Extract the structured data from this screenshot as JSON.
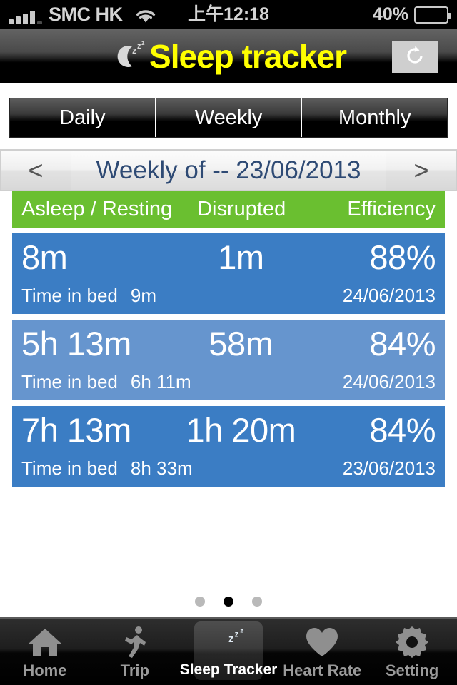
{
  "statusbar": {
    "carrier": "SMC HK",
    "time": "上午12:18",
    "battery_percent": "40%",
    "battery_level": 40,
    "signal_icon": "signal-bars-icon",
    "wifi_icon": "wifi-icon",
    "battery_icon": "battery-icon"
  },
  "header": {
    "title": "Sleep tracker",
    "title_color": "#ffff00",
    "moon_icon": "sleep-moon-zzz-icon",
    "refresh_icon": "refresh-icon",
    "refresh_label": "Refresh"
  },
  "segments": {
    "items": [
      {
        "label": "Daily",
        "selected": false
      },
      {
        "label": "Weekly",
        "selected": true
      },
      {
        "label": "Monthly",
        "selected": false
      }
    ]
  },
  "datenav": {
    "prev_label": "<",
    "next_label": ">",
    "current": "Weekly of -- 23/06/2013",
    "text_color": "#2e4a74"
  },
  "table": {
    "header_color": "#6abf30",
    "columns": [
      "Asleep / Resting",
      "Disrupted",
      "Efficiency"
    ],
    "sub_label": "Time in bed",
    "row_colors": [
      "#3b7dc4",
      "#6695ce"
    ],
    "rows": [
      {
        "asleep": "8m",
        "disrupted": "1m",
        "efficiency": "88%",
        "time_in_bed_label": "Time in bed",
        "time_in_bed": "9m",
        "date": "24/06/2013",
        "bg": "#3b7dc4"
      },
      {
        "asleep": "5h 13m",
        "disrupted": "58m",
        "efficiency": "84%",
        "time_in_bed_label": "Time in bed",
        "time_in_bed": "6h 11m",
        "date": "24/06/2013",
        "bg": "#6695ce"
      },
      {
        "asleep": "7h 13m",
        "disrupted": "1h 20m",
        "efficiency": "84%",
        "time_in_bed_label": "Time in bed",
        "time_in_bed": "8h 33m",
        "date": "23/06/2013",
        "bg": "#3b7dc4"
      }
    ]
  },
  "pager": {
    "count": 3,
    "active_index": 1
  },
  "tabbar": {
    "items": [
      {
        "label": "Home",
        "icon": "home-icon",
        "active": false
      },
      {
        "label": "Trip",
        "icon": "running-person-icon",
        "active": false
      },
      {
        "label": "Sleep Tracker",
        "icon": "sleep-moon-zzz-icon",
        "active": true
      },
      {
        "label": "Heart Rate",
        "icon": "heart-icon",
        "active": false
      },
      {
        "label": "Setting",
        "icon": "gear-icon",
        "active": false
      }
    ]
  }
}
